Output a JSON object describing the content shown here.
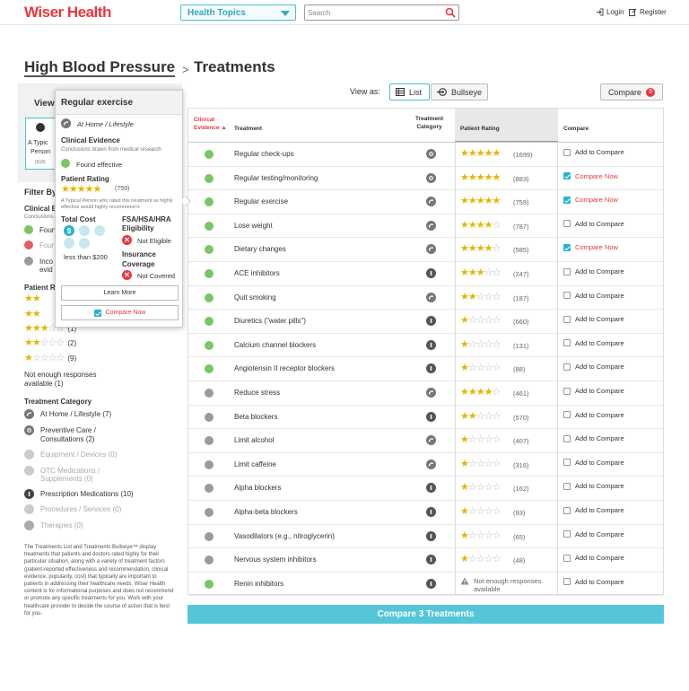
{
  "header": {
    "logo": "Wiser Health",
    "topics_label": "Health Topics",
    "search_placeholder": "Search",
    "login": "Login",
    "register": "Register"
  },
  "breadcrumb": {
    "condition": "High Blood Pressure",
    "separator": ">",
    "page": "Treatments"
  },
  "view": {
    "label": "View as:",
    "list": "List",
    "bullseye": "Bullseye",
    "compare": "Compare",
    "compare_count": "3"
  },
  "sidebar": {
    "view_label": "View",
    "card_text": [
      "A Typic",
      "Person",
      "(818)"
    ],
    "filter_label": "Filter By",
    "clinical_title": "Clinical E",
    "clinical_sub": "Conclusions",
    "clinical_items": [
      "Foun",
      "Four",
      "Inco",
      "evid"
    ],
    "patient_title": "Patient R",
    "rating_counts": [
      "(1)",
      "(2)",
      "(9)"
    ],
    "not_enough": "Not enough responses",
    "available": "available (1)",
    "category_title": "Treatment Category",
    "categories": [
      {
        "label": "At Home / Lifestyle (7)",
        "enabled": true
      },
      {
        "label": "Preventive Care /",
        "label2": "Consultations (2)",
        "enabled": true
      },
      {
        "label": "Equipment / Devices (0)",
        "enabled": false
      },
      {
        "label": "OTC Medications /",
        "label2": "Supplements (0)",
        "enabled": false
      },
      {
        "label": "Prescription Medications (10)",
        "enabled": true
      },
      {
        "label": "Procedures / Services (0)",
        "enabled": false
      },
      {
        "label": "Therapies (0)",
        "enabled": false
      }
    ],
    "disclaimer": "The Treatments List and Treatments Bullseye™ display treatments that patients and doctors rated highly for their particular situation, along with a variety of treatment factors (patient-reported effectiveness and recommendation, clinical evidence, popularity, cost) that typically are important to patients in addressing their healthcare needs. Wiser Health content is for informational purposes and does not recommend or promote any specific treatments for you. Work with your healthcare provider to decide the course of action that is best for you."
  },
  "popup": {
    "title": "Regular exercise",
    "category": "At Home / Lifestyle",
    "clinical_title": "Clinical Evidence",
    "clinical_sub": "Conclusions drawn from medical research",
    "clinical_value": "Found effective",
    "rating_title": "Patient Rating",
    "rating_count": "(759)",
    "rating_text": "A Typical Person who rated this treatment as highly effective would highly recommend it.",
    "cost_title": "Total Cost",
    "cost_value": "less than $200",
    "fsa_title": "FSA/HSA/HRA",
    "fsa_title2": "Eligibility",
    "fsa_value": "Not Eligible",
    "ins_title": "Insurance",
    "ins_title2": "Coverage",
    "ins_value": "Not Covered",
    "learn_more": "Learn More",
    "compare_now": "Compare Now"
  },
  "table": {
    "headers": {
      "clinical1": "Clinical",
      "clinical2": "Evidence ▲",
      "treatment": "Treatment",
      "category1": "Treatment",
      "category2": "Category",
      "rating": "Patient Rating",
      "compare": "Compare"
    },
    "add_label": "Add to Compare",
    "now_label": "Compare Now",
    "not_enough": "Not enough responses",
    "not_enough2": "available",
    "rows": [
      {
        "name": "Regular check-ups",
        "evidence": "green",
        "category": "preventive",
        "stars": 5,
        "count": "(1699)",
        "compare": false
      },
      {
        "name": "Regular testing/monitoring",
        "evidence": "green",
        "category": "preventive",
        "stars": 5,
        "count": "(883)",
        "compare": true
      },
      {
        "name": "Regular exercise",
        "evidence": "green",
        "category": "lifestyle",
        "stars": 5,
        "count": "(759)",
        "compare": true
      },
      {
        "name": "Lose weight",
        "evidence": "green",
        "category": "lifestyle",
        "stars": 4,
        "count": "(787)",
        "compare": false
      },
      {
        "name": "Dietary changes",
        "evidence": "green",
        "category": "lifestyle",
        "stars": 4,
        "count": "(585)",
        "compare": true
      },
      {
        "name": "ACE inhibitors",
        "evidence": "green",
        "category": "prescription",
        "stars": 3,
        "count": "(247)",
        "compare": false
      },
      {
        "name": "Quit smoking",
        "evidence": "green",
        "category": "lifestyle",
        "stars": 2,
        "count": "(187)",
        "compare": false
      },
      {
        "name": "Diuretics (\"water pills\")",
        "evidence": "green",
        "category": "prescription",
        "stars": 1,
        "count": "(660)",
        "compare": false
      },
      {
        "name": "Calcium channel blockers",
        "evidence": "green",
        "category": "prescription",
        "stars": 1,
        "count": "(131)",
        "compare": false
      },
      {
        "name": "Angiotensin II receptor blockers",
        "evidence": "green",
        "category": "prescription",
        "stars": 1,
        "count": "(88)",
        "compare": false
      },
      {
        "name": "Reduce stress",
        "evidence": "gray",
        "category": "lifestyle",
        "stars": 4,
        "count": "(461)",
        "compare": false
      },
      {
        "name": "Beta blockers",
        "evidence": "gray",
        "category": "prescription",
        "stars": 2,
        "count": "(570)",
        "compare": false
      },
      {
        "name": "Limit alcohol",
        "evidence": "gray",
        "category": "lifestyle",
        "stars": 1,
        "count": "(407)",
        "compare": false
      },
      {
        "name": "Limit caffeine",
        "evidence": "gray",
        "category": "lifestyle",
        "stars": 1,
        "count": "(316)",
        "compare": false
      },
      {
        "name": "Alpha blockers",
        "evidence": "gray",
        "category": "prescription",
        "stars": 1,
        "count": "(162)",
        "compare": false
      },
      {
        "name": "Alpha-beta blockers",
        "evidence": "gray",
        "category": "prescription",
        "stars": 1,
        "count": "(93)",
        "compare": false
      },
      {
        "name": "Vasodilators (e.g., nitroglycerin)",
        "evidence": "gray",
        "category": "prescription",
        "stars": 1,
        "count": "(65)",
        "compare": false
      },
      {
        "name": "Nervous system inhibitors",
        "evidence": "gray",
        "category": "prescription",
        "stars": 1,
        "count": "(48)",
        "compare": false
      },
      {
        "name": "Renin inhibitors",
        "evidence": "green",
        "category": "prescription",
        "stars": 0,
        "count": "",
        "compare": false
      }
    ]
  },
  "footer_button": "Compare 3 Treatments",
  "colors": {
    "brand_red": "#e8373f",
    "accent_teal": "#4bbecf",
    "evidence_green": "#7ac663",
    "evidence_gray": "#9b9b9b",
    "evidence_red": "#e06060",
    "star": "#e8b400"
  }
}
